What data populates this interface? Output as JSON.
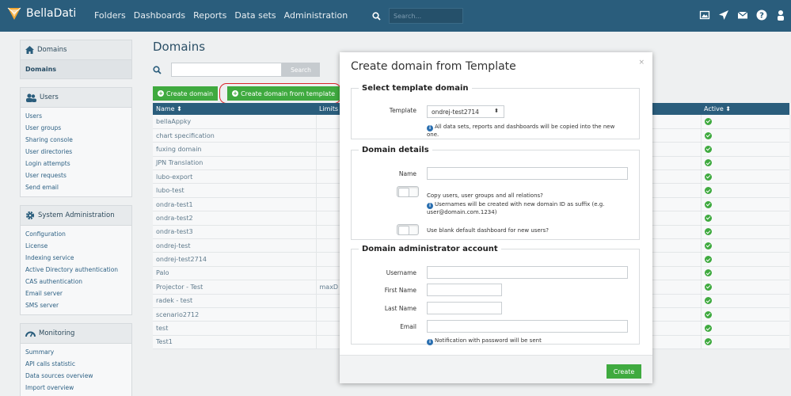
{
  "app": {
    "name": "BellaDati"
  },
  "topnav": [
    "Folders",
    "Dashboards",
    "Reports",
    "Data sets",
    "Administration"
  ],
  "topsearch": {
    "placeholder": "Search..."
  },
  "topicons": [
    "image-icon",
    "rocket-icon",
    "mail-icon",
    "help-icon",
    "user-icon"
  ],
  "sidebar": {
    "domains": {
      "title": "Domains",
      "active": "Domains"
    },
    "users": {
      "title": "Users",
      "items": [
        "Users",
        "User groups",
        "Sharing console",
        "User directories",
        "Login attempts",
        "User requests",
        "Send email"
      ]
    },
    "sysadmin": {
      "title": "System Administration",
      "items": [
        "Configuration",
        "License",
        "Indexing service",
        "Active Directory authentication",
        "CAS authentication",
        "Email server",
        "SMS server"
      ]
    },
    "monitoring": {
      "title": "Monitoring",
      "items": [
        "Summary",
        "API calls statistic",
        "Data sources overview",
        "Import overview"
      ]
    }
  },
  "main": {
    "title": "Domains",
    "search_button": "Search",
    "create_domain": "Create domain",
    "create_from_template": "Create domain from template",
    "columns": {
      "name": "Name ⬍",
      "limits": "Limits",
      "active": "Active ⬍"
    },
    "rows": [
      {
        "name": "bellaAppky",
        "limits": ""
      },
      {
        "name": "chart specification",
        "limits": ""
      },
      {
        "name": "fuxing domain",
        "limits": ""
      },
      {
        "name": "JPN Translation",
        "limits": ""
      },
      {
        "name": "lubo-export",
        "limits": ""
      },
      {
        "name": "lubo-test",
        "limits": ""
      },
      {
        "name": "ondra-test1",
        "limits": ""
      },
      {
        "name": "ondra-test2",
        "limits": ""
      },
      {
        "name": "ondra-test3",
        "limits": ""
      },
      {
        "name": "ondrej-test",
        "limits": ""
      },
      {
        "name": "ondrej-test2714",
        "limits": ""
      },
      {
        "name": "Palo",
        "limits": ""
      },
      {
        "name": "Projector - Test",
        "limits": "maxD"
      },
      {
        "name": "radek - test",
        "limits": ""
      },
      {
        "name": "scenario2712",
        "limits": ""
      },
      {
        "name": "test",
        "limits": ""
      },
      {
        "name": "Test1",
        "limits": ""
      }
    ]
  },
  "modal": {
    "title": "Create domain from Template",
    "close": "×",
    "section1": {
      "legend": "Select template domain",
      "template_label": "Template",
      "template_value": "ondrej-test2714",
      "info": "All data sets, reports and dashboards will be copied into the new one."
    },
    "section2": {
      "legend": "Domain details",
      "name_label": "Name",
      "copy_users": "Copy users, user groups and all relations?",
      "suffix_info": "Usernames will be created with new domain ID as suffix (e.g. user@domain.com.1234)",
      "blank_dash": "Use blank default dashboard for new users?"
    },
    "section3": {
      "legend": "Domain administrator account",
      "username": "Username",
      "firstname": "First Name",
      "lastname": "Last Name",
      "email": "Email",
      "info": "Notification with password will be sent"
    },
    "create": "Create"
  }
}
